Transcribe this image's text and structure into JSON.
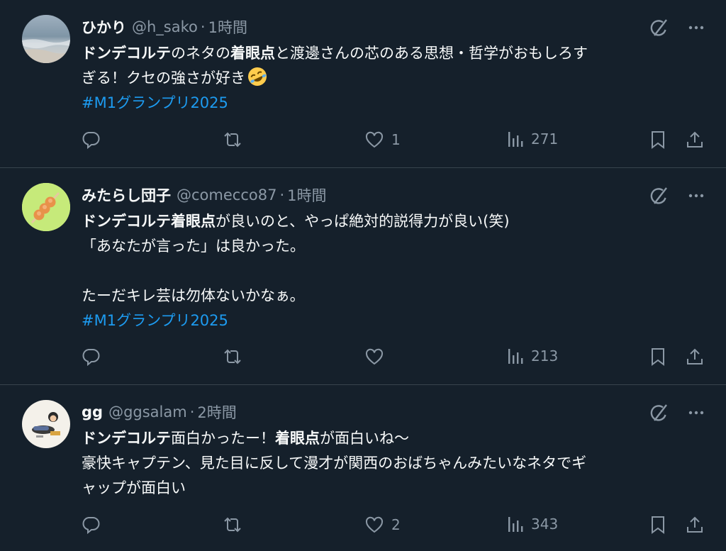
{
  "posts": [
    {
      "name": "ひかり",
      "handle": "@h_sako",
      "separator": "·",
      "time": "1時間",
      "lines": [
        [
          {
            "b": "ドンデコルテ"
          },
          {
            "t": "のネタの"
          },
          {
            "b": "着眼点"
          },
          {
            "t": "と渡邊さんの芯のある思想・哲学がおもしろす"
          }
        ],
        [
          {
            "t": "ぎる！クセの強さが好き"
          },
          {
            "emoji": "rofl"
          }
        ]
      ],
      "hashtag": " #M1グランプリ2025",
      "actions": {
        "reply": "",
        "repost": "",
        "like": "1",
        "views": "271"
      }
    },
    {
      "name": "みたらし団子",
      "handle": "@comecco87",
      "separator": "·",
      "time": "1時間",
      "lines": [
        [
          {
            "b": "ドンデコルテ着眼点"
          },
          {
            "t": "が良いのと、やっぱ絶対的説得力が良い(笑)"
          }
        ],
        [
          {
            "t": "「あなたが言った」は良かった。"
          }
        ],
        [],
        [
          {
            "t": "たーだキレ芸は勿体ないかなぁ。"
          }
        ]
      ],
      "hashtag": "#M1グランプリ2025",
      "actions": {
        "reply": "",
        "repost": "",
        "like": "",
        "views": "213"
      }
    },
    {
      "name": "gg",
      "handle": "@ggsalam",
      "separator": "·",
      "time": "2時間",
      "lines": [
        [
          {
            "b": "ドンデコルテ"
          },
          {
            "t": "面白かったー！"
          },
          {
            "b": "着眼点"
          },
          {
            "t": "が面白いね〜"
          }
        ],
        [
          {
            "t": "豪快キャプテン、見た目に反して漫才が関西のおばちゃんみたいなネタでギ"
          }
        ],
        [
          {
            "t": "ャップが面白い"
          }
        ]
      ],
      "hashtag": "",
      "actions": {
        "reply": "",
        "repost": "",
        "like": "2",
        "views": "343"
      }
    }
  ],
  "icons": {
    "grok": "grok-icon",
    "more": "more-icon",
    "reply": "reply-icon",
    "repost": "repost-icon",
    "like": "like-icon",
    "views": "views-icon",
    "bookmark": "bookmark-icon",
    "share": "share-icon"
  },
  "colors": {
    "background": "#15202b",
    "text": "#f7f9f9",
    "muted": "#8b98a5",
    "link": "#1d9bf0",
    "divider": "#38444d"
  }
}
